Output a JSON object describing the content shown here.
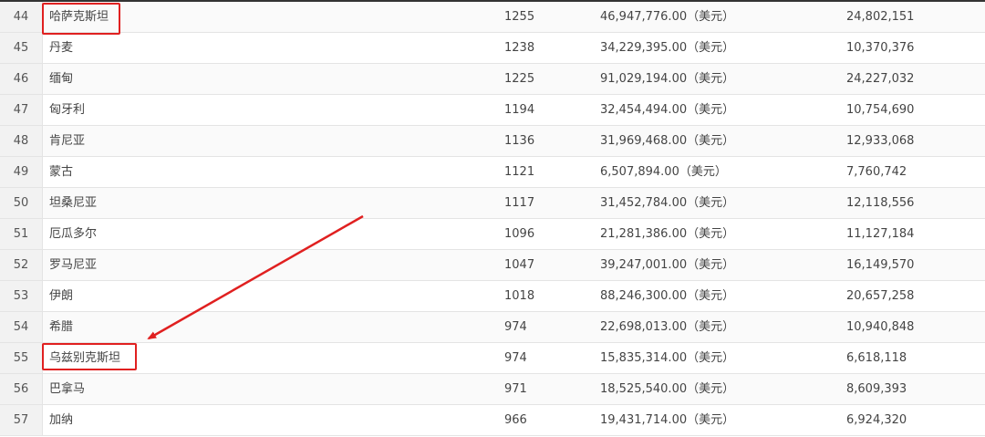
{
  "table": {
    "rows": [
      {
        "rank": "44",
        "country": "哈萨克斯坦",
        "value": "1255",
        "gdp": "46,947,776.00（美元）",
        "population": "24,802,151"
      },
      {
        "rank": "45",
        "country": "丹麦",
        "value": "1238",
        "gdp": "34,229,395.00（美元）",
        "population": "10,370,376"
      },
      {
        "rank": "46",
        "country": "缅甸",
        "value": "1225",
        "gdp": "91,029,194.00（美元）",
        "population": "24,227,032"
      },
      {
        "rank": "47",
        "country": "匈牙利",
        "value": "1194",
        "gdp": "32,454,494.00（美元）",
        "population": "10,754,690"
      },
      {
        "rank": "48",
        "country": "肯尼亚",
        "value": "1136",
        "gdp": "31,969,468.00（美元）",
        "population": "12,933,068"
      },
      {
        "rank": "49",
        "country": "蒙古",
        "value": "1121",
        "gdp": "6,507,894.00（美元）",
        "population": "7,760,742"
      },
      {
        "rank": "50",
        "country": "坦桑尼亚",
        "value": "1117",
        "gdp": "31,452,784.00（美元）",
        "population": "12,118,556"
      },
      {
        "rank": "51",
        "country": "厄瓜多尔",
        "value": "1096",
        "gdp": "21,281,386.00（美元）",
        "population": "11,127,184"
      },
      {
        "rank": "52",
        "country": "罗马尼亚",
        "value": "1047",
        "gdp": "39,247,001.00（美元）",
        "population": "16,149,570"
      },
      {
        "rank": "53",
        "country": "伊朗",
        "value": "1018",
        "gdp": "88,246,300.00（美元）",
        "population": "20,657,258"
      },
      {
        "rank": "54",
        "country": "希腊",
        "value": "974",
        "gdp": "22,698,013.00（美元）",
        "population": "10,940,848"
      },
      {
        "rank": "55",
        "country": "乌兹别克斯坦",
        "value": "974",
        "gdp": "15,835,314.00（美元）",
        "population": "6,618,118"
      },
      {
        "rank": "56",
        "country": "巴拿马",
        "value": "971",
        "gdp": "18,525,540.00（美元）",
        "population": "8,609,393"
      },
      {
        "rank": "57",
        "country": "加纳",
        "value": "966",
        "gdp": "19,431,714.00（美元）",
        "population": "6,924,320"
      }
    ]
  },
  "annotations": {
    "highlight_color": "#e02020",
    "highlighted_countries": [
      "哈萨克斯坦",
      "乌兹别克斯坦"
    ]
  }
}
